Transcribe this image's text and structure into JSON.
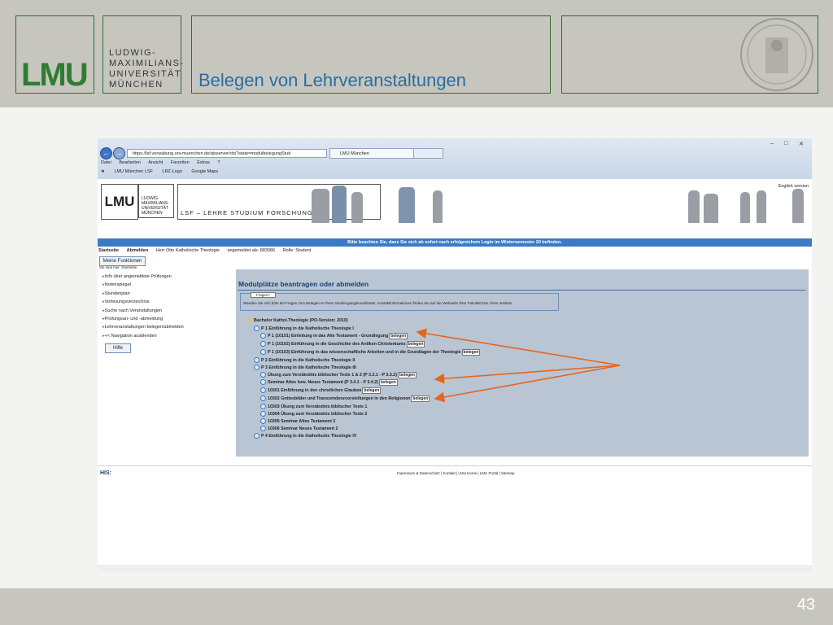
{
  "slide": {
    "title": "Belegen von Lehrveranstaltungen",
    "logo_text": "LMU",
    "university_name": [
      "LUDWIG-",
      "MAXIMILIANS-",
      "UNIVERSITÄT",
      "MÜNCHEN"
    ],
    "page_number": "43",
    "accent_color": "#2f7d32"
  },
  "browser": {
    "url": "https://lsf.verwaltung.uni-muenchen.de/qisserver/rds?state=modulbelegungStud",
    "tab_title": "LMU München",
    "menu": [
      "Datei",
      "Bearbeiten",
      "Ansicht",
      "Favoriten",
      "Extras",
      "?"
    ],
    "favorites": [
      "LMU München LSF",
      "LRZ-Logo",
      "Google Maps"
    ]
  },
  "lsf": {
    "logo_text": "LMU",
    "logo_name": [
      "LUDWIG-",
      "MAXIMILIANS-",
      "UNIVERSITÄT",
      "MÜNCHEN"
    ],
    "banner_text": "LSF – LEHRE STUDIUM FORSCHUNG",
    "english_link": "English version",
    "notice": "Bitte beachten Sie, dass Sie sich ab sofort nach erfolgreichem Login im Wintersemester 20      befinden.",
    "user_bar": [
      "Startseite",
      "Abmelden",
      "Herr Otto Katholische Theologie",
      "angemeldet als: 883086",
      "Rolle: Student"
    ],
    "my_functions": "Meine Funktionen",
    "you_are_here": "Sie sind hier: Startseite",
    "side_nav": [
      "Info über angemeldete Prüfungen",
      "Notenspiegel",
      "Stundenplan",
      "Vorlesungsverzeichnis",
      "Suche nach Veranstaltungen",
      "Prüfungsan- und -abmeldung",
      "Lehrveranstaltungen belegen/abmelden",
      "<< Navigation ausblenden"
    ],
    "help": "Hilfe",
    "panel_title": "Modulplätze beantragen oder abmelden",
    "fragen_button": "Fragen?",
    "fragen_text": "Wenden Sie sich bitte bei Fragen zum Belegen an Ihren Studiengangskoordinator. Kontaktinformationen finden Sie auf der Webseite Ihrer Fakultät bzw. Ihres Instituts.",
    "belegen": "belegen",
    "tree": [
      {
        "label": "Bachelor Kathol.Theologie (PO-Version: 2010)"
      },
      {
        "label": "P 1 Einführung in die Katholische Theologie I"
      },
      {
        "label": "P 1 (10101) Einleitung in das Alte Testament - Grundlegung",
        "btn": true
      },
      {
        "label": "P 1 (10102) Einführung in die Geschichte des Antiken Christentums",
        "btn": true
      },
      {
        "label": "P 1 (10103) Einführung in das wissenschaftliche Arbeiten und in die Grundlagen der Theologie",
        "btn": true
      },
      {
        "label": "P 2 Einführung in die Katholische Theologie II"
      },
      {
        "label": "P 3 Einführung in die Katholische Theologie III"
      },
      {
        "label": "Übung zum Verständnis biblischer Texte 1 & 2 (P 3.3.1 - P 3.3.2)",
        "btn": true
      },
      {
        "label": "Seminar Altes bzw. Neues Testament (P 3.4.1 - P 3.4.2)",
        "btn": true
      },
      {
        "label": "10301 Einführung in den christlichen Glauben",
        "btn": true
      },
      {
        "label": "10302 Gottesbilder und Transzendenzvorstellungen in den Religionen",
        "btn": true
      },
      {
        "label": "10303 Übung zum Verständnis biblischer Texte 1"
      },
      {
        "label": "10304 Übung zum Verständnis biblischer Texte 2"
      },
      {
        "label": "10305 Seminar Altes Testament 2"
      },
      {
        "label": "10306 Seminar Neues Testament 2"
      },
      {
        "label": "P 4 Einführung in die Katholische Theologie IV"
      }
    ],
    "footer_his": "HIS:",
    "footer_links": "Impressum & Datenschutz | Kontakt | LMU Home | LMU Portal | Sitemap",
    "arrow_color": "#e8641c"
  }
}
